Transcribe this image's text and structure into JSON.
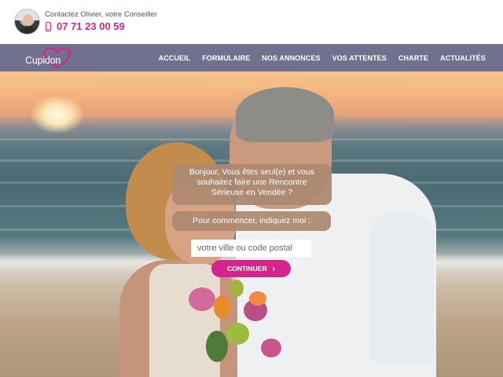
{
  "topbar": {
    "contact_text": "Contactez Olivier, votre Conseiller",
    "phone": "07 71 23 00 59",
    "avatar_icon": "advisor-avatar",
    "phone_icon": "mobile-phone-icon"
  },
  "nav": {
    "logo_text": "Cupidon",
    "logo_icon": "heart-logo",
    "links": [
      {
        "label": "Accueil"
      },
      {
        "label": "Formulaire"
      },
      {
        "label": "Nos annonces"
      },
      {
        "label": "Vos attentes"
      },
      {
        "label": "Charte"
      },
      {
        "label": "Actualités"
      }
    ]
  },
  "hero": {
    "greeting": "Bonjour, Vous êtes seul(e) et vous souhaitez faire une Rencontre Sérieuse en Vendée ?",
    "prompt": "Pour commencer, indiquez moi :",
    "city_placeholder": "votre ville ou code postal",
    "cta_label": "Continuer",
    "cta_icon": "chevron-right-icon"
  },
  "colors": {
    "accent": "#d6248e",
    "nav_bg": "#71718f",
    "bubble_bg": "#ac8971"
  }
}
